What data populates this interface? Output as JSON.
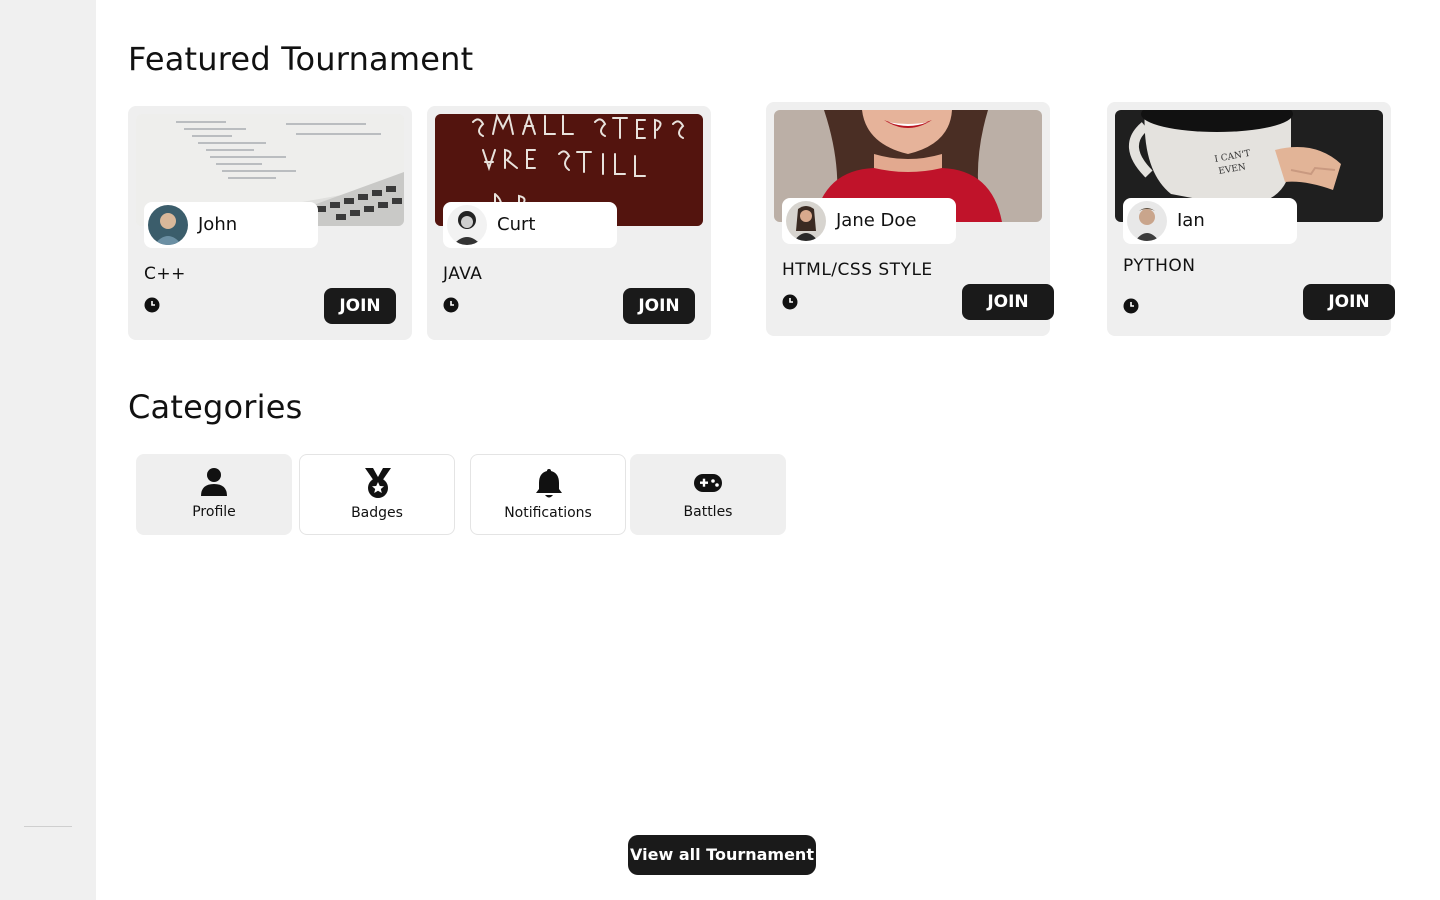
{
  "featured": {
    "heading": "Featured Tournament",
    "tournaments": [
      {
        "owner": "John",
        "title": "C++",
        "join_label": "JOIN",
        "image_icon": "code-laptop-image",
        "avatar_icon": "john-avatar"
      },
      {
        "owner": "Curt",
        "title": "JAVA",
        "join_label": "JOIN",
        "image_icon": "chalk-writing-image",
        "avatar_icon": "curt-avatar"
      },
      {
        "owner": "Jane Doe",
        "title": "HTML/CSS STYLE",
        "join_label": "JOIN",
        "image_icon": "smiling-woman-image",
        "avatar_icon": "jane-doe-avatar"
      },
      {
        "owner": "Ian",
        "title": "PYTHON",
        "join_label": "JOIN",
        "image_icon": "coffee-mug-image",
        "avatar_icon": "ian-avatar"
      }
    ]
  },
  "categories": {
    "heading": "Categories",
    "items": [
      {
        "label": "Profile",
        "icon": "person-icon"
      },
      {
        "label": "Badges",
        "icon": "medal-icon"
      },
      {
        "label": "Notifications",
        "icon": "bell-icon"
      },
      {
        "label": "Battles",
        "icon": "gamepad-icon"
      }
    ]
  },
  "footer": {
    "view_all_label": "View all Tournament"
  },
  "colors": {
    "button_bg": "#1a1a1a",
    "card_bg": "#efefef",
    "sidebar_bg": "#f0f0f0"
  }
}
